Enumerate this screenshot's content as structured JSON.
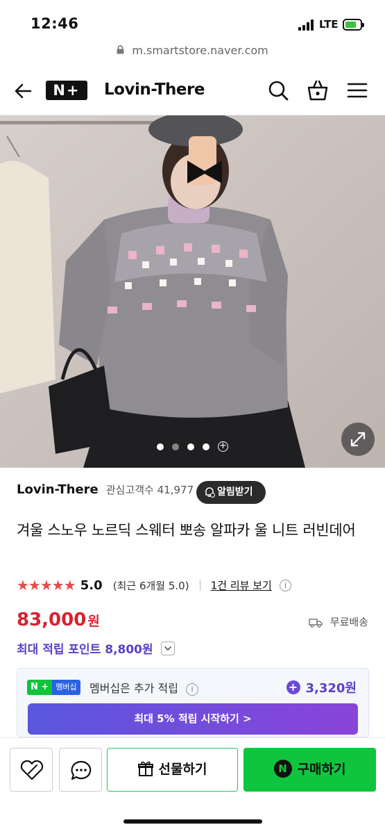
{
  "status_bar": {
    "time": "12:46",
    "network": "LTE",
    "battery_level": 0.6
  },
  "browser": {
    "url": "m.smartstore.naver.com"
  },
  "header": {
    "logo_text": "N+",
    "store_title": "Lovin-There",
    "icons": [
      "back-arrow-icon",
      "search-icon",
      "shopping-bag-icon",
      "menu-icon"
    ]
  },
  "gallery": {
    "page_count": 4,
    "current_index": 0,
    "more_label": "+"
  },
  "product": {
    "store_name": "Lovin-There",
    "fans_label": "관심고객수 41,977",
    "alarm_button": "알림받기",
    "title": "겨울 스노우 노르딕 스웨터 뽀송 알파카 울 니트 러빈데어",
    "stars": "★★★★★",
    "rating": "5.0",
    "recent_rating": "(최근 6개월 5.0)",
    "review_link": "1건 리뷰 보기",
    "price": "83,000",
    "price_unit": "원",
    "shipping": "무료배송",
    "points_label": "최대 적립 포인트 8,800원"
  },
  "membership": {
    "badge_n": "N +",
    "badge_label": "멤버십",
    "text": "멤버십은 추가 적립",
    "point_plus": "+",
    "point": "3,320원",
    "cta": "최대 5% 적립 시작하기 >"
  },
  "bottom_bar": {
    "gift_button": "선물하기",
    "buy_button": "구매하기",
    "buy_badge": "N"
  },
  "colors": {
    "price_red": "#d8222f",
    "points_purple": "#5b3fc9",
    "naver_green": "#0ec53d",
    "star_red": "#e44b4b"
  }
}
